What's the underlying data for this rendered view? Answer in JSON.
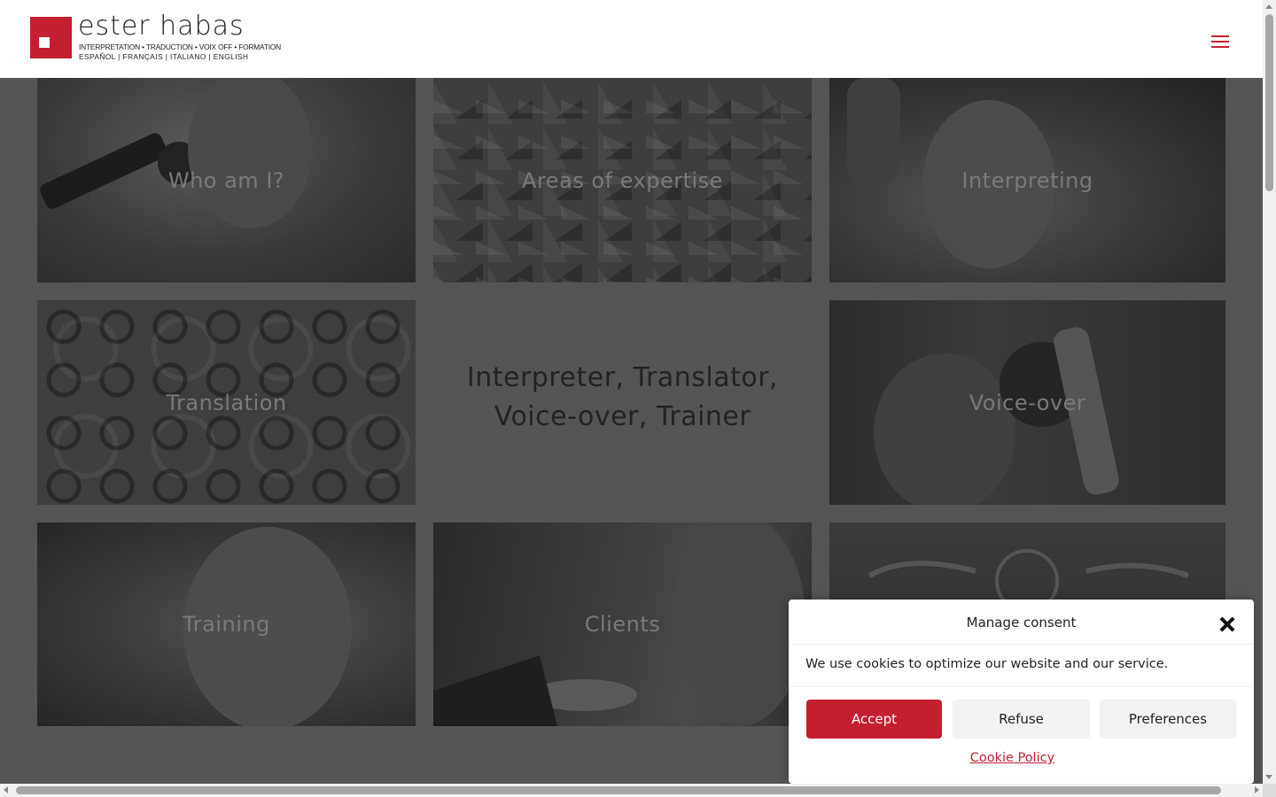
{
  "header": {
    "logo": {
      "name": "ester habas",
      "tagline": "INTERPRETATION • TRADUCTION • VOIX OFF • FORMATION",
      "languages": "ESPAÑOL  |  FRANÇAIS  |  ITALIANO  |  ENGLISH"
    },
    "menu_icon": "hamburger-menu-icon"
  },
  "tiles": [
    {
      "label": "Who am I?",
      "image": "singer-at-microphone"
    },
    {
      "label": "Areas of expertise",
      "image": "photo-collage"
    },
    {
      "label": "Interpreting",
      "image": "woman-in-booth"
    },
    {
      "label": "Translation",
      "image": "gears"
    },
    {
      "label": "Voice-over",
      "image": "woman-with-studio-mic"
    },
    {
      "label": "Training",
      "image": "woman-portrait"
    },
    {
      "label": "Clients",
      "image": "handshake-headset"
    },
    {
      "label": "",
      "image": "service-quality-chalkboard"
    }
  ],
  "center_heading": {
    "line1": "Interpreter, Translator,",
    "line2": "Voice-over, Trainer"
  },
  "consent": {
    "title": "Manage consent",
    "message": "We use cookies to optimize our website and our service.",
    "accept": "Accept",
    "refuse": "Refuse",
    "preferences": "Preferences",
    "cookie_policy": "Cookie Policy",
    "close_icon": "close-icon"
  },
  "colors": {
    "brand": "#c41f2f",
    "overlay": "#555555"
  }
}
